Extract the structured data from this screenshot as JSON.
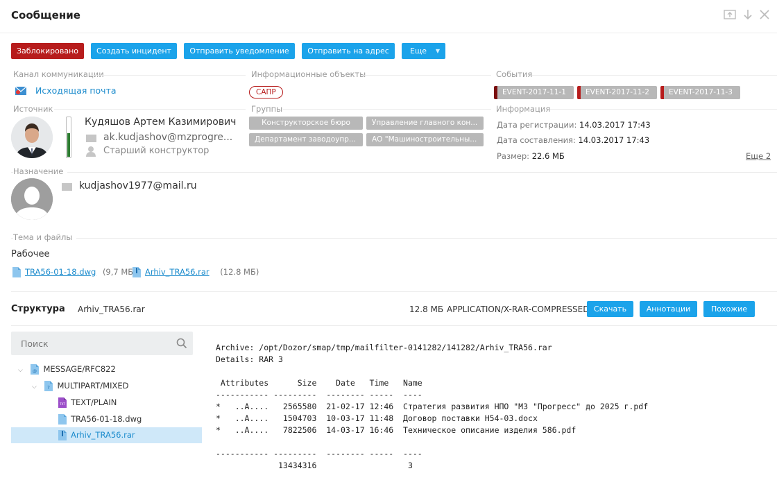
{
  "header": {
    "title": "Сообщение"
  },
  "toolbar": {
    "blocked": "Заблокировано",
    "create_incident": "Создать инцидент",
    "send_notification": "Отправить уведомление",
    "send_to_address": "Отправить на адрес",
    "more": "Еще"
  },
  "channel": {
    "label": "Канал коммуникации",
    "value": "Исходящая почта"
  },
  "info_objects": {
    "label": "Информационные объекты",
    "tag": "САПР"
  },
  "events": {
    "label": "События",
    "items": [
      "EVENT-2017-11-1",
      "EVENT-2017-11-2",
      "EVENT-2017-11-3"
    ]
  },
  "source": {
    "label": "Источник",
    "name": "Кудяшов Артем Казимирович",
    "email": "ak.kudjashov@mzprogre...",
    "position": "Старший конструктор"
  },
  "groups": {
    "label": "Группы",
    "items": [
      "Конструкторское бюро",
      "Управление главного кон...",
      "Департамент заводоупр...",
      "АО \"Машиностроительны..."
    ]
  },
  "info": {
    "label": "Информация",
    "reg_label": "Дата регистрации:",
    "reg_value": "14.03.2017 17:43",
    "comp_label": "Дата составления:",
    "comp_value": "14.03.2017 17:43",
    "size_label": "Размер:",
    "size_value": "22.6 МБ",
    "more_link": "Еще 2"
  },
  "destination": {
    "label": "Назначение",
    "email": "kudjashov1977@mail.ru"
  },
  "subject": {
    "label": "Тема и файлы",
    "text": "Рабочее",
    "files": [
      {
        "name": "TRA56-01-18.dwg",
        "size": "(9,7 МБ)"
      },
      {
        "name": "Arhiv_TRA56.rar",
        "size": "(12.8 МБ)"
      }
    ]
  },
  "structure": {
    "label": "Структура",
    "file": "Arhiv_TRA56.rar",
    "size": "12.8 МБ",
    "mime": "APPLICATION/X-RAR-COMPRESSED",
    "download": "Скачать",
    "annotations": "Аннотации",
    "similar": "Похожие"
  },
  "search": {
    "placeholder": "Поиск"
  },
  "tree": [
    {
      "label": "MESSAGE/RFC822"
    },
    {
      "label": "MULTIPART/MIXED"
    },
    {
      "label": "TEXT/PLAIN"
    },
    {
      "label": "TRA56-01-18.dwg"
    },
    {
      "label": "Arhiv_TRA56.rar"
    }
  ],
  "content": {
    "lines": [
      "Archive: /opt/Dozor/smap/tmp/mailfilter-0141282/141282/Arhiv_TRA56.rar",
      "Details: RAR 3",
      "",
      " Attributes      Size    Date   Time   Name",
      "----------- ---------  -------- -----  ----",
      "*   ..A....   2565580  21-02-17 12:46  Стратегия развития НПО \"МЗ \"Прогресс\" до 2025 г.pdf",
      "*   ..A....   1504703  10-03-17 11:48  Договор поставки Н54-03.docx",
      "*   ..A....   7822506  14-03-17 16:46  Техническое описание изделия 586.pdf",
      "",
      "----------- ---------  -------- -----  ----",
      "             13434316                   3"
    ]
  },
  "colors": {
    "accent": "#1ba3ea",
    "danger": "#b71c1c",
    "chip": "#b8b8b8",
    "selected": "#cfe8f9"
  }
}
